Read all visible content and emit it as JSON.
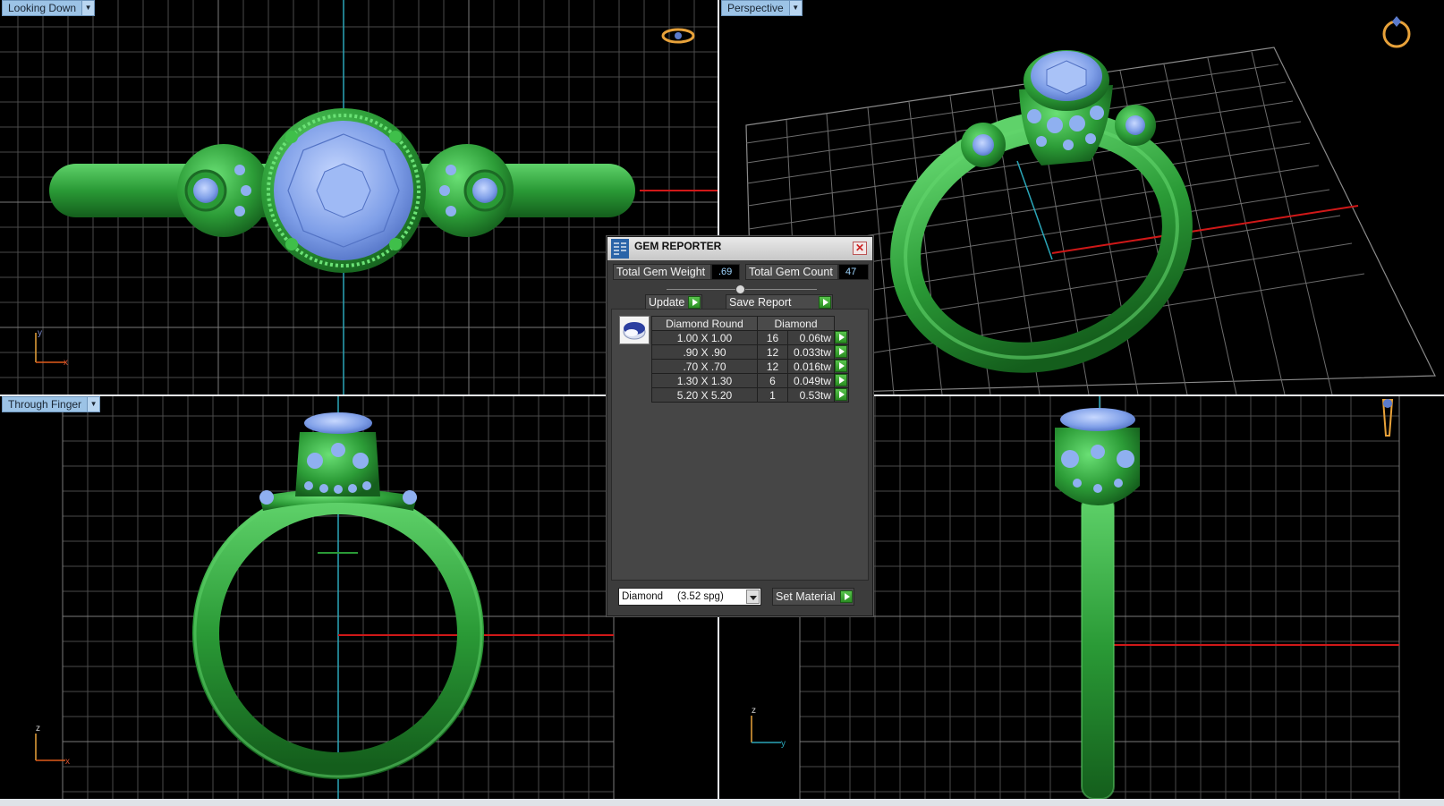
{
  "viewports": {
    "top_left": {
      "label": "Looking Down",
      "axis_a": "y",
      "axis_b": "x"
    },
    "top_right": {
      "label": "Perspective"
    },
    "bottom_left": {
      "label": "Through Finger",
      "axis_a": "z",
      "axis_b": "x"
    },
    "bottom_right": {
      "axis_a": "z",
      "axis_b": "y"
    }
  },
  "gem_reporter": {
    "title": "GEM REPORTER",
    "total_weight_label": "Total Gem Weight",
    "total_weight_value": ".69",
    "total_count_label": "Total Gem Count",
    "total_count_value": "47",
    "update_label": "Update",
    "save_report_label": "Save Report",
    "table": {
      "headers": [
        "Diamond Round",
        "Diamond"
      ],
      "rows": [
        {
          "size": "1.00 X 1.00",
          "count": "16",
          "weight": "0.06tw"
        },
        {
          "size": ".90 X .90",
          "count": "12",
          "weight": "0.033tw"
        },
        {
          "size": ".70 X .70",
          "count": "12",
          "weight": "0.016tw"
        },
        {
          "size": "1.30 X 1.30",
          "count": "6",
          "weight": "0.049tw"
        },
        {
          "size": "5.20 X 5.20",
          "count": "1",
          "weight": "0.53tw"
        }
      ]
    },
    "material_select": "Diamond     (3.52 spg)",
    "set_material_label": "Set Material"
  },
  "colors": {
    "metal": "#2fa63e",
    "gem": "#8fb0f0",
    "grid": "#5a5a5a",
    "axis_x": "#d01818",
    "axis_y": "#2aa6b8",
    "label_bg": "#9cc3e6"
  }
}
